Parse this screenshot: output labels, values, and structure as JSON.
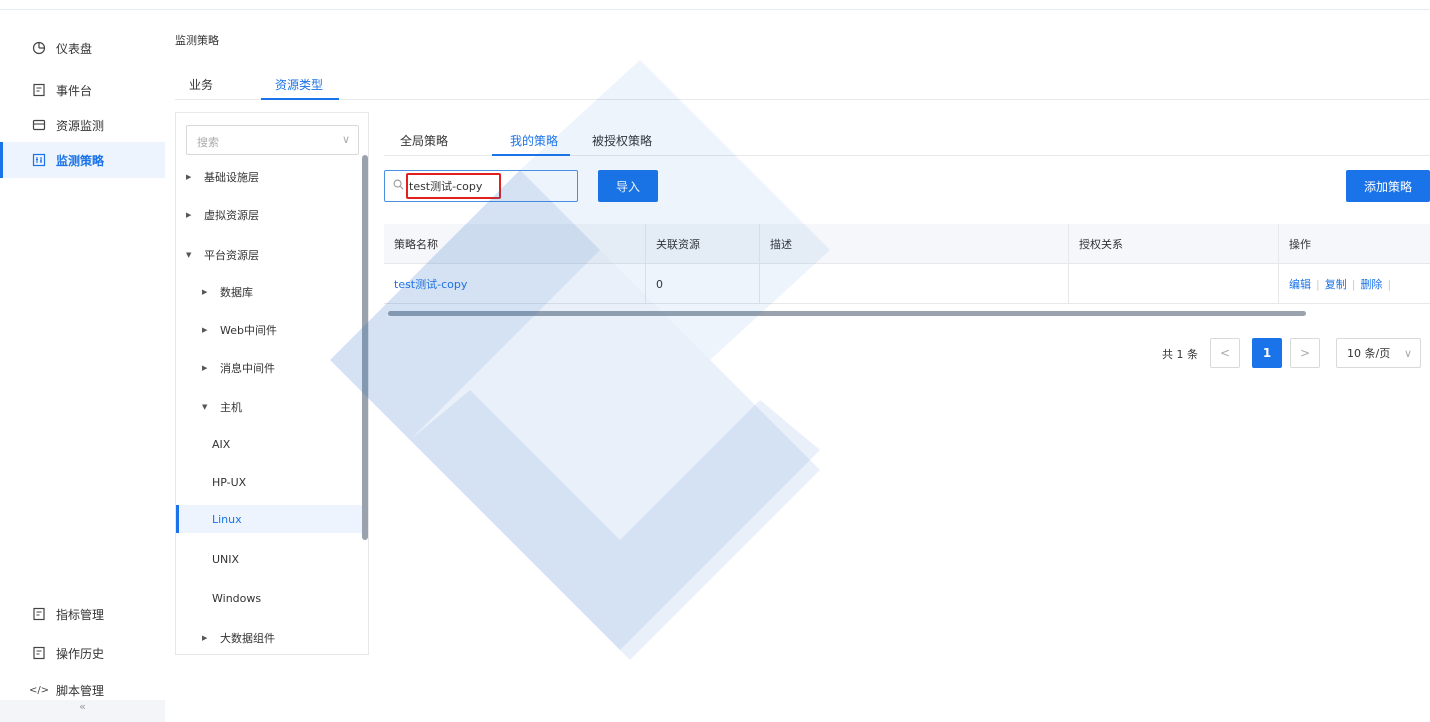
{
  "sidebar": {
    "items": [
      {
        "label": "仪表盘",
        "icon": "dashboard-icon"
      },
      {
        "label": "事件台",
        "icon": "event-icon"
      },
      {
        "label": "资源监测",
        "icon": "monitor-icon"
      },
      {
        "label": "监测策略",
        "icon": "strategy-icon",
        "active": true
      },
      {
        "label": "指标管理",
        "icon": "metrics-icon"
      },
      {
        "label": "操作历史",
        "icon": "history-icon"
      },
      {
        "label": "脚本管理",
        "icon": "code-icon"
      }
    ],
    "collapse_label": "«"
  },
  "header": {
    "breadcrumb": "监测策略",
    "tabs": [
      {
        "label": "业务"
      },
      {
        "label": "资源类型",
        "active": true
      }
    ]
  },
  "tree": {
    "search_placeholder": "搜索",
    "nodes": [
      {
        "label": "基础设施层",
        "arrow": "▶"
      },
      {
        "label": "虚拟资源层",
        "arrow": "▶"
      },
      {
        "label": "平台资源层",
        "arrow": "▼"
      },
      {
        "label": "数据库",
        "arrow": "▶"
      },
      {
        "label": "Web中间件",
        "arrow": "▶"
      },
      {
        "label": "消息中间件",
        "arrow": "▶"
      },
      {
        "label": "主机",
        "arrow": "▼"
      },
      {
        "label": "AIX",
        "arrow": ""
      },
      {
        "label": "HP-UX",
        "arrow": ""
      },
      {
        "label": "Linux",
        "arrow": "",
        "selected": true
      },
      {
        "label": "UNIX",
        "arrow": ""
      },
      {
        "label": "Windows",
        "arrow": ""
      },
      {
        "label": "大数据组件",
        "arrow": "▶"
      }
    ]
  },
  "main": {
    "sub_tabs": [
      {
        "label": "全局策略"
      },
      {
        "label": "我的策略",
        "active": true
      },
      {
        "label": "被授权策略"
      }
    ],
    "search_value": "test测试-copy",
    "import_label": "导入",
    "add_label": "添加策略",
    "table": {
      "columns": [
        "策略名称",
        "关联资源",
        "描述",
        "授权关系",
        "操作"
      ],
      "rows": [
        {
          "name": "test测试-copy",
          "resources": "0",
          "desc": "",
          "auth": "",
          "actions": [
            "编辑",
            "复制",
            "删除"
          ]
        }
      ]
    },
    "pagination": {
      "total": "共 1 条",
      "prev": "<",
      "current": "1",
      "next": ">",
      "page_size": "10 条/页"
    }
  },
  "colors": {
    "accent": "#1a73e8",
    "highlight_box": "#e0201c"
  }
}
